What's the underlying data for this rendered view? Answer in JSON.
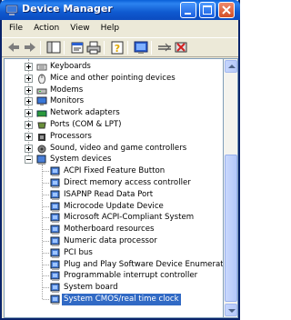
{
  "window": {
    "title": "Device Manager"
  },
  "menu": [
    "File",
    "Action",
    "View",
    "Help"
  ],
  "toolbar": {
    "icons": [
      "back-icon",
      "forward-icon",
      "show-hide-console-tree-icon",
      "properties-icon",
      "print-icon",
      "help-icon",
      "scan-hardware-icon",
      "disable-device-icon",
      "uninstall-device-icon"
    ]
  },
  "tree": {
    "categories": [
      {
        "label": "Keyboards",
        "icon": "keyboard-icon"
      },
      {
        "label": "Mice and other pointing devices",
        "icon": "mouse-icon"
      },
      {
        "label": "Modems",
        "icon": "modem-icon"
      },
      {
        "label": "Monitors",
        "icon": "monitor-icon"
      },
      {
        "label": "Network adapters",
        "icon": "network-adapter-icon"
      },
      {
        "label": "Ports (COM & LPT)",
        "icon": "port-icon"
      },
      {
        "label": "Processors",
        "icon": "processor-icon"
      },
      {
        "label": "Sound, video and game controllers",
        "icon": "sound-icon"
      },
      {
        "label": "System devices",
        "icon": "system-devices-icon"
      }
    ],
    "system_devices": [
      "ACPI Fixed Feature Button",
      "Direct memory access controller",
      "ISAPNP Read Data Port",
      "Microcode Update Device",
      "Microsoft ACPI-Compliant System",
      "Motherboard resources",
      "Numeric data processor",
      "PCI bus",
      "Plug and Play Software Device Enumerator",
      "Programmable interrupt controller",
      "System board",
      "System CMOS/real time clock"
    ],
    "selected": "System CMOS/real time clock"
  },
  "colors": {
    "title_bar": "#0a5fd8",
    "selection": "#316ac5"
  }
}
